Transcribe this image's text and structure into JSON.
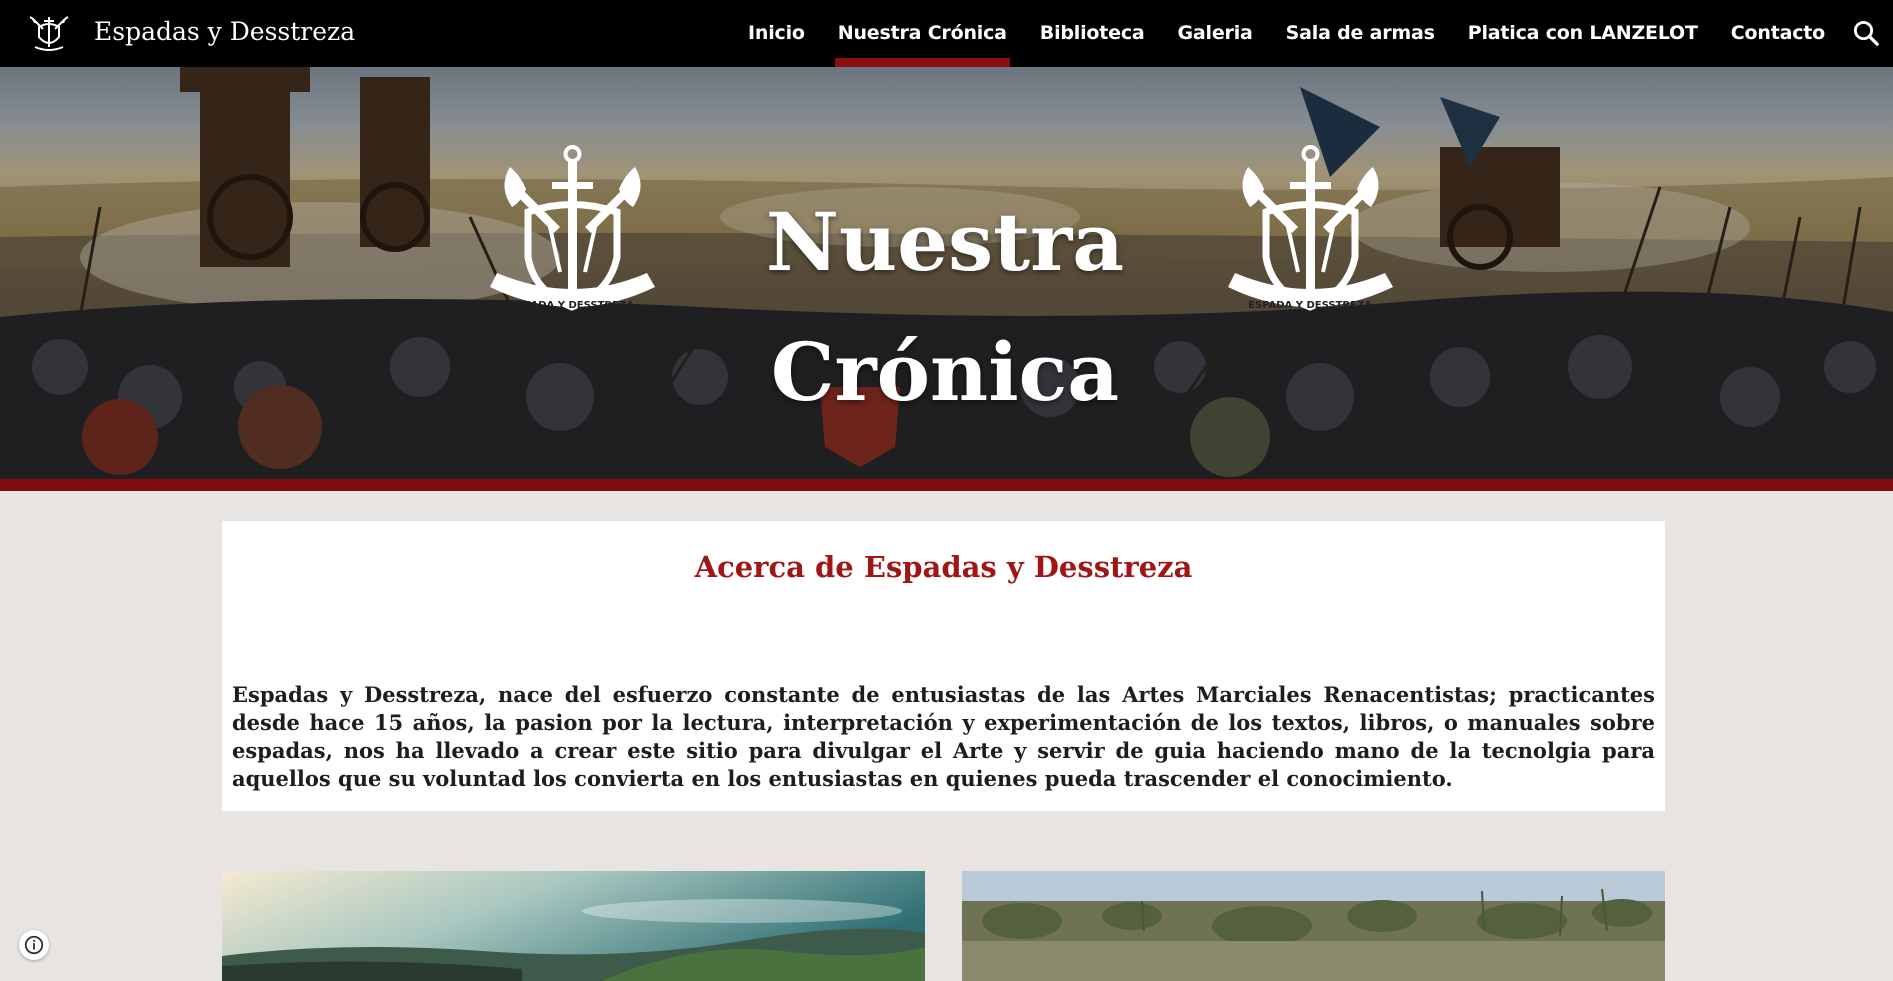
{
  "header": {
    "site_name": "Espadas y Desstreza",
    "nav": [
      {
        "label": "Inicio",
        "active": false
      },
      {
        "label": "Nuestra Crónica",
        "active": true
      },
      {
        "label": "Biblioteca",
        "active": false
      },
      {
        "label": "Galeria",
        "active": false
      },
      {
        "label": "Sala de armas",
        "active": false
      },
      {
        "label": "Platica con LANZELOT",
        "active": false
      },
      {
        "label": "Contacto",
        "active": false
      }
    ],
    "search_icon": "search-icon"
  },
  "hero": {
    "title_line1": "Nuestra",
    "title_line2": "Crónica",
    "emblem_text": "ESPADA Y DESSTREZA"
  },
  "about": {
    "title": "Acerca de Espadas y Desstreza",
    "body": "Espadas y Desstreza, nace del esfuerzo constante de entusiastas de las Artes Marciales Renacentistas; practicantes desde hace 15 años, la pasion por la lectura, interpretación y experimentación de los textos, libros, o manuales sobre espadas, nos ha llevado a crear este sitio para divulgar el Arte y servir de guia haciendo mano de la tecnolgia para aquellos que su voluntad los convierta en los entusiastas en quienes pueda trascender el conocimiento."
  },
  "colors": {
    "nav_bg": "#000000",
    "accent": "#8b0f0f",
    "about_title": "#a01616",
    "page_bg": "#e8e4e2"
  },
  "icons": {
    "info": "info-icon",
    "logo": "crest-logo-icon"
  }
}
